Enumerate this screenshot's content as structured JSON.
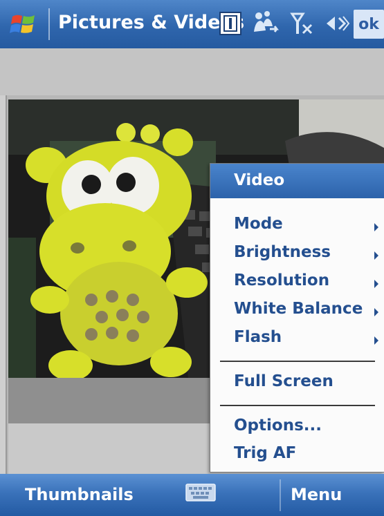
{
  "titlebar": {
    "title": "Pictures & Videos",
    "ok_label": "ok",
    "icons": [
      "windows-start-icon",
      "notification-icon",
      "connectivity-icon",
      "signal-off-icon",
      "volume-icon"
    ]
  },
  "menu": {
    "header": "Video",
    "items": [
      {
        "label": "Mode",
        "submenu": true
      },
      {
        "label": "Brightness",
        "submenu": true
      },
      {
        "label": "Resolution",
        "submenu": true
      },
      {
        "label": "White Balance",
        "submenu": true
      },
      {
        "label": "Flash",
        "submenu": true
      },
      {
        "label": "Full Screen",
        "submenu": false
      },
      {
        "label": "Options...",
        "submenu": false
      },
      {
        "label": "Trig AF",
        "submenu": false
      }
    ]
  },
  "softkeys": {
    "left": "Thumbnails",
    "right": "Menu"
  },
  "colors": {
    "titlebar_blue": "#2f66ad",
    "menu_text": "#244f8f",
    "menu_bg": "#fbfbfb"
  }
}
